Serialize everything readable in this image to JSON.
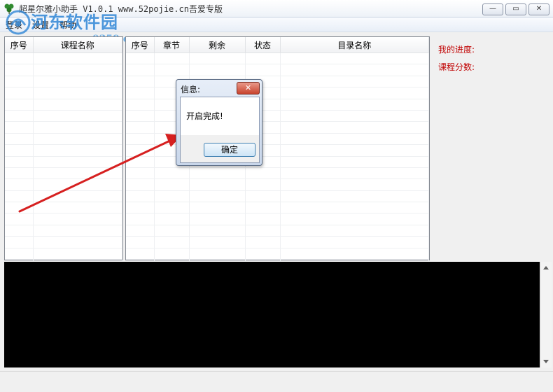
{
  "window": {
    "title": "超星尔雅小助手 V1.0.1   www.52pojie.cn吾爱专版",
    "minimize_glyph": "—",
    "maximize_glyph": "▭",
    "close_glyph": "✕"
  },
  "watermark": {
    "site_name": "河东软件园",
    "url": "www.pc0359.cn"
  },
  "menu": {
    "items": [
      "登录",
      "设置",
      "帮助"
    ]
  },
  "course_table": {
    "columns": [
      "序号",
      "课程名称"
    ]
  },
  "chapter_table": {
    "columns": [
      "序号",
      "章节",
      "剩余",
      "状态",
      "目录名称"
    ]
  },
  "info_panel": {
    "progress_label": "我的进度:",
    "score_label": "课程分数:"
  },
  "dialog": {
    "title": "信息:",
    "message": "开启完成!",
    "ok_label": "确定",
    "close_glyph": "✕"
  },
  "colors": {
    "accent_red": "#c00000",
    "arrow_red": "#d62020",
    "console_bg": "#000000",
    "watermark_blue": "#2f86d6"
  }
}
